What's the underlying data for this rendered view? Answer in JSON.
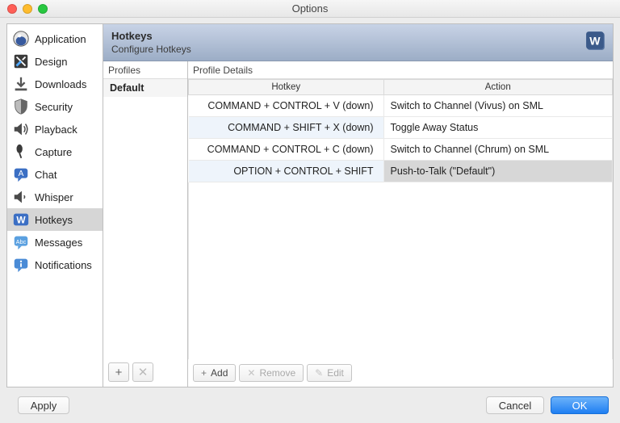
{
  "window": {
    "title": "Options"
  },
  "sidebar": {
    "items": [
      {
        "label": "Application"
      },
      {
        "label": "Design"
      },
      {
        "label": "Downloads"
      },
      {
        "label": "Security"
      },
      {
        "label": "Playback"
      },
      {
        "label": "Capture"
      },
      {
        "label": "Chat"
      },
      {
        "label": "Whisper"
      },
      {
        "label": "Hotkeys",
        "selected": true
      },
      {
        "label": "Messages"
      },
      {
        "label": "Notifications"
      }
    ]
  },
  "header": {
    "title": "Hotkeys",
    "subtitle": "Configure Hotkeys"
  },
  "profiles": {
    "title": "Profiles",
    "items": [
      {
        "name": "Default",
        "selected": true
      }
    ],
    "buttons": {
      "add": "+",
      "remove": "✕"
    }
  },
  "details": {
    "title": "Profile Details",
    "columns": {
      "hotkey": "Hotkey",
      "action": "Action"
    },
    "rows": [
      {
        "hotkey": "COMMAND + CONTROL + V (down)",
        "action": "Switch to Channel (Vivus) on SML"
      },
      {
        "hotkey": "COMMAND + SHIFT + X (down)",
        "action": "Toggle Away Status",
        "alt": true
      },
      {
        "hotkey": "COMMAND + CONTROL + C (down)",
        "action": "Switch to Channel (Chrum) on SML"
      },
      {
        "hotkey": "OPTION + CONTROL + SHIFT",
        "action": "Push-to-Talk (\"Default\")",
        "selected": true
      }
    ],
    "buttons": {
      "add": "Add",
      "remove": "Remove",
      "edit": "Edit"
    }
  },
  "footer": {
    "apply": "Apply",
    "cancel": "Cancel",
    "ok": "OK"
  }
}
